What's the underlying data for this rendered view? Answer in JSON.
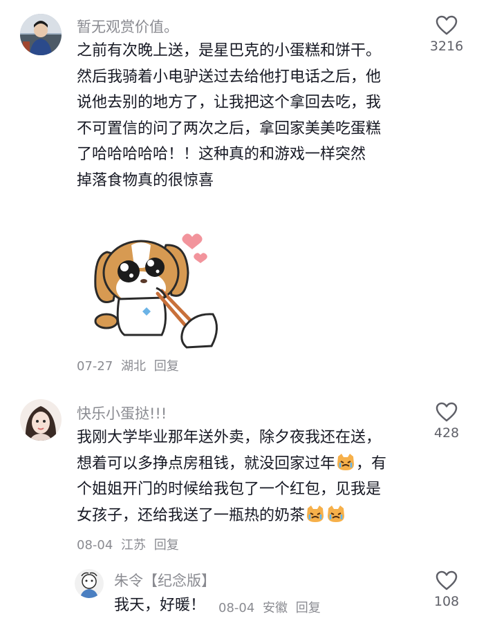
{
  "comments": [
    {
      "username": "暂无观赏价值。",
      "lines": [
        "之前有次晚上送，是星巴克的小蛋糕和饼干。",
        "然后我骑着小电驴送过去给他打电话之后，他",
        "说他去别的地方了，让我把这个拿回去吃，我",
        "不可置信的问了两次之后，拿回家美美吃蛋糕",
        "了哈哈哈哈哈！！这种真的和游戏一样突然",
        "掉落食物真的很惊喜"
      ],
      "sticker": "puppy-eating-sticker",
      "date": "07-27",
      "location": "湖北",
      "reply_label": "回复",
      "likes": "3216"
    },
    {
      "username": "快乐小蛋挞!!!",
      "lines": [
        "我刚大学毕业那年送外卖，除夕夜我还在送，",
        "想着可以多挣点房租钱，就没回家过年",
        "，有",
        "个姐姐开门的时候给我包了一个红包，见我是",
        "女孩子，还给我送了一瓶热的奶茶"
      ],
      "emoji": "crying-cat-emoji",
      "date": "08-04",
      "location": "江苏",
      "reply_label": "回复",
      "likes": "428"
    }
  ],
  "reply": {
    "username": "朱令【纪念版】",
    "text": "我天，好暖！",
    "date": "08-04",
    "location": "安徽",
    "reply_label": "回复",
    "likes": "108"
  },
  "icons": {
    "like": "heart-outline-icon"
  },
  "colors": {
    "text": "#161823",
    "secondary": "#8a8b91",
    "background": "#ffffff"
  }
}
